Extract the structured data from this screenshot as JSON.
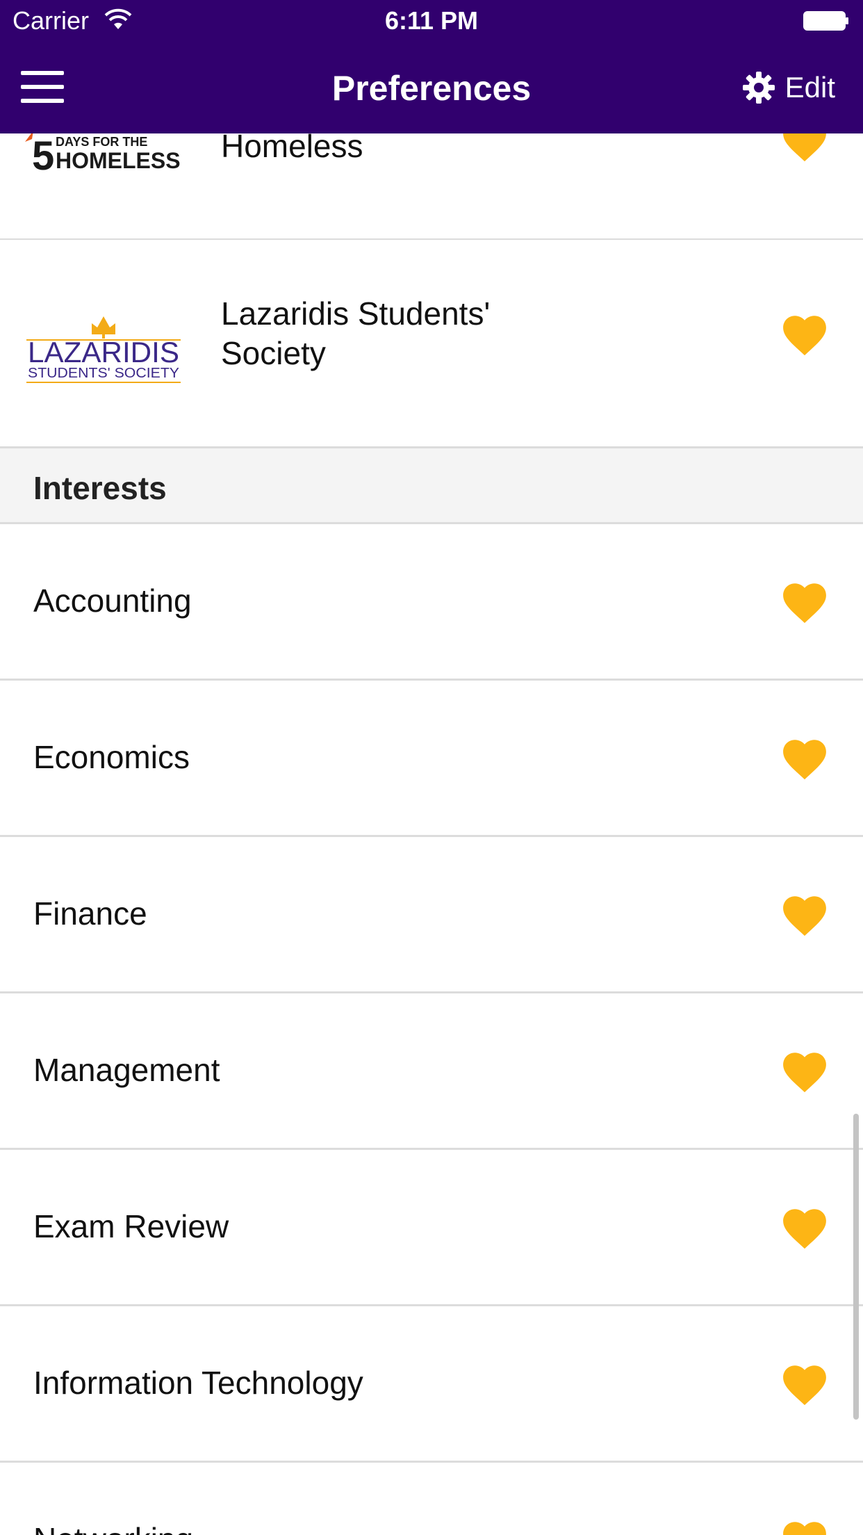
{
  "status_bar": {
    "carrier": "Carrier",
    "time": "6:11 PM"
  },
  "nav": {
    "title": "Preferences",
    "edit_label": "Edit"
  },
  "organizations": [
    {
      "name": "Homeless",
      "logo_text": "5 DAYS FOR THE HOMELESS",
      "favorited": true
    },
    {
      "name": "Lazaridis Students' Society",
      "name_lines": [
        "Lazaridis Students'",
        "Society"
      ],
      "logo_text": "LAZARIDIS STUDENTS' SOCIETY",
      "favorited": true
    }
  ],
  "interests_header": "Interests",
  "interests": [
    {
      "label": "Accounting",
      "favorited": true
    },
    {
      "label": "Economics",
      "favorited": true
    },
    {
      "label": "Finance",
      "favorited": true
    },
    {
      "label": "Management",
      "favorited": true
    },
    {
      "label": "Exam Review",
      "favorited": true
    },
    {
      "label": "Information Technology",
      "favorited": true
    },
    {
      "label": "Networking",
      "favorited": true
    }
  ],
  "colors": {
    "nav_bg": "#31006e",
    "heart": "#fdb515",
    "logo_purple": "#3b2888",
    "logo_gold": "#f3ab17"
  }
}
